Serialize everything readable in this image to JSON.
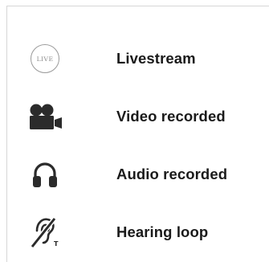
{
  "legend": {
    "items": [
      {
        "icon": "livestream-icon",
        "icon_text": "LIVE",
        "label": "Livestream"
      },
      {
        "icon": "video-camera-icon",
        "label": "Video recorded"
      },
      {
        "icon": "headphones-icon",
        "label": "Audio recorded"
      },
      {
        "icon": "hearing-loop-icon",
        "label": "Hearing loop"
      }
    ]
  },
  "colors": {
    "icon": "#2b2b2b",
    "badge_border": "#9a9a9a",
    "label": "#1a1a1a",
    "panel_border": "#d6d6d6"
  }
}
